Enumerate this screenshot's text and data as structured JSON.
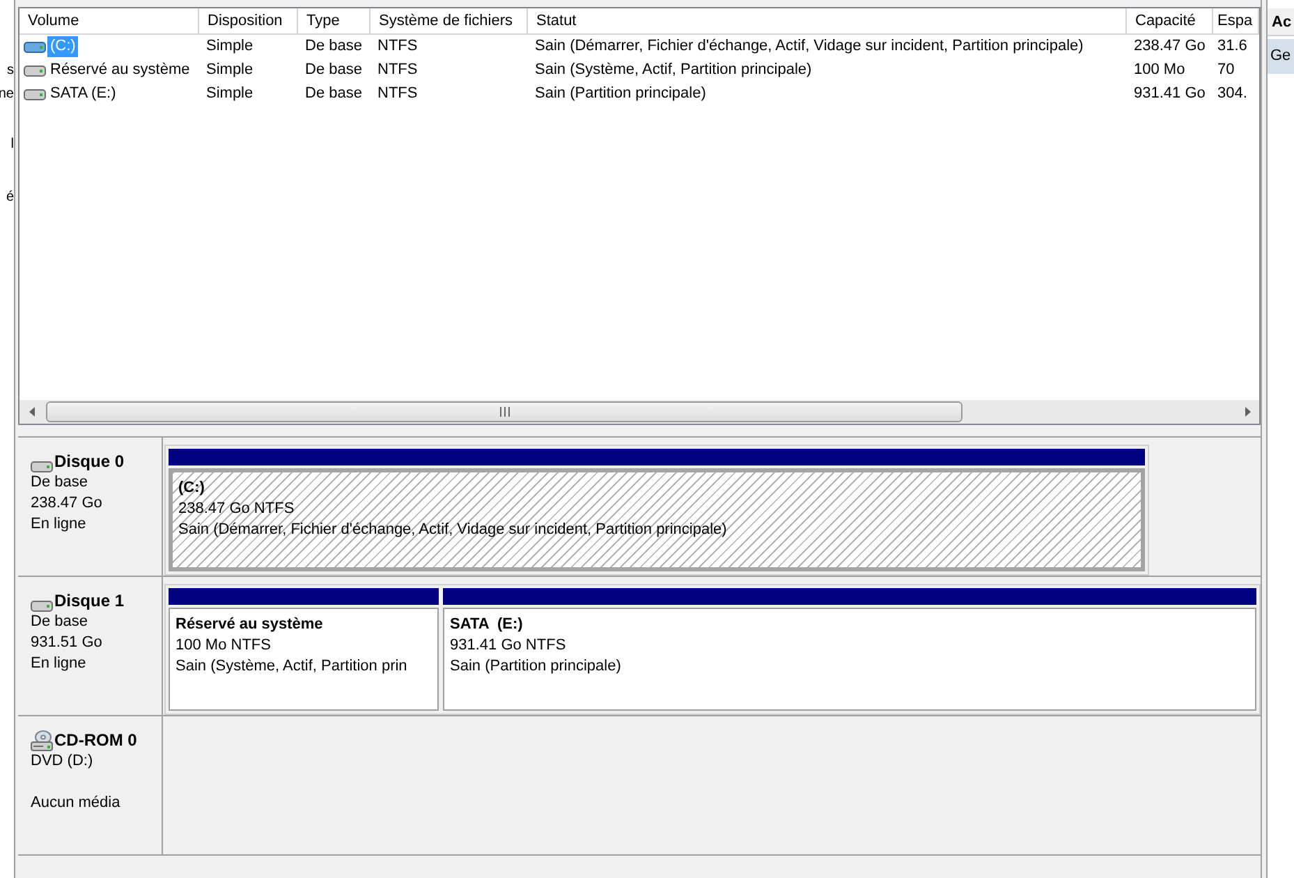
{
  "left_pane": {
    "items": [
      "s",
      "ne",
      "l",
      "é"
    ]
  },
  "volume_list": {
    "columns": [
      "Volume",
      "Disposition",
      "Type",
      "Système de fichiers",
      "Statut",
      "Capacité",
      "Espa"
    ],
    "rows": [
      {
        "selected": true,
        "cells": [
          "(C:)",
          "Simple",
          "De base",
          "NTFS",
          "Sain (Démarrer, Fichier d'échange, Actif, Vidage sur incident, Partition principale)",
          "238.47 Go",
          "31.6"
        ]
      },
      {
        "selected": false,
        "cells": [
          "Réservé au système",
          "Simple",
          "De base",
          "NTFS",
          "Sain (Système, Actif, Partition principale)",
          "100 Mo",
          "70"
        ]
      },
      {
        "selected": false,
        "cells": [
          "SATA (E:)",
          "Simple",
          "De base",
          "NTFS",
          "Sain (Partition principale)",
          "931.41 Go",
          "304."
        ]
      }
    ]
  },
  "disks": [
    {
      "kind": "disk",
      "name": "Disque 0",
      "type": "De base",
      "size": "238.47 Go",
      "status": "En ligne",
      "partitions": [
        {
          "name": "(C:)",
          "size": "238.47 Go NTFS",
          "status": "Sain (Démarrer, Fichier d'échange, Actif, Vidage sur incident, Partition principale)",
          "selected": true
        }
      ]
    },
    {
      "kind": "disk",
      "name": "Disque 1",
      "type": "De base",
      "size": "931.51 Go",
      "status": "En ligne",
      "partitions": [
        {
          "name": "Réservé au système",
          "size": "100 Mo NTFS",
          "status": "Sain (Système, Actif, Partition prin",
          "selected": false
        },
        {
          "name": "SATA  (E:)",
          "size": "931.41 Go NTFS",
          "status": "Sain (Partition principale)",
          "selected": false
        }
      ]
    },
    {
      "kind": "cdrom",
      "name": "CD-ROM 0",
      "type": "DVD (D:)",
      "status": "Aucun média"
    }
  ],
  "actions_pane": {
    "title": "Ac",
    "items": [
      {
        "label": "Ge",
        "selected": true
      }
    ]
  }
}
